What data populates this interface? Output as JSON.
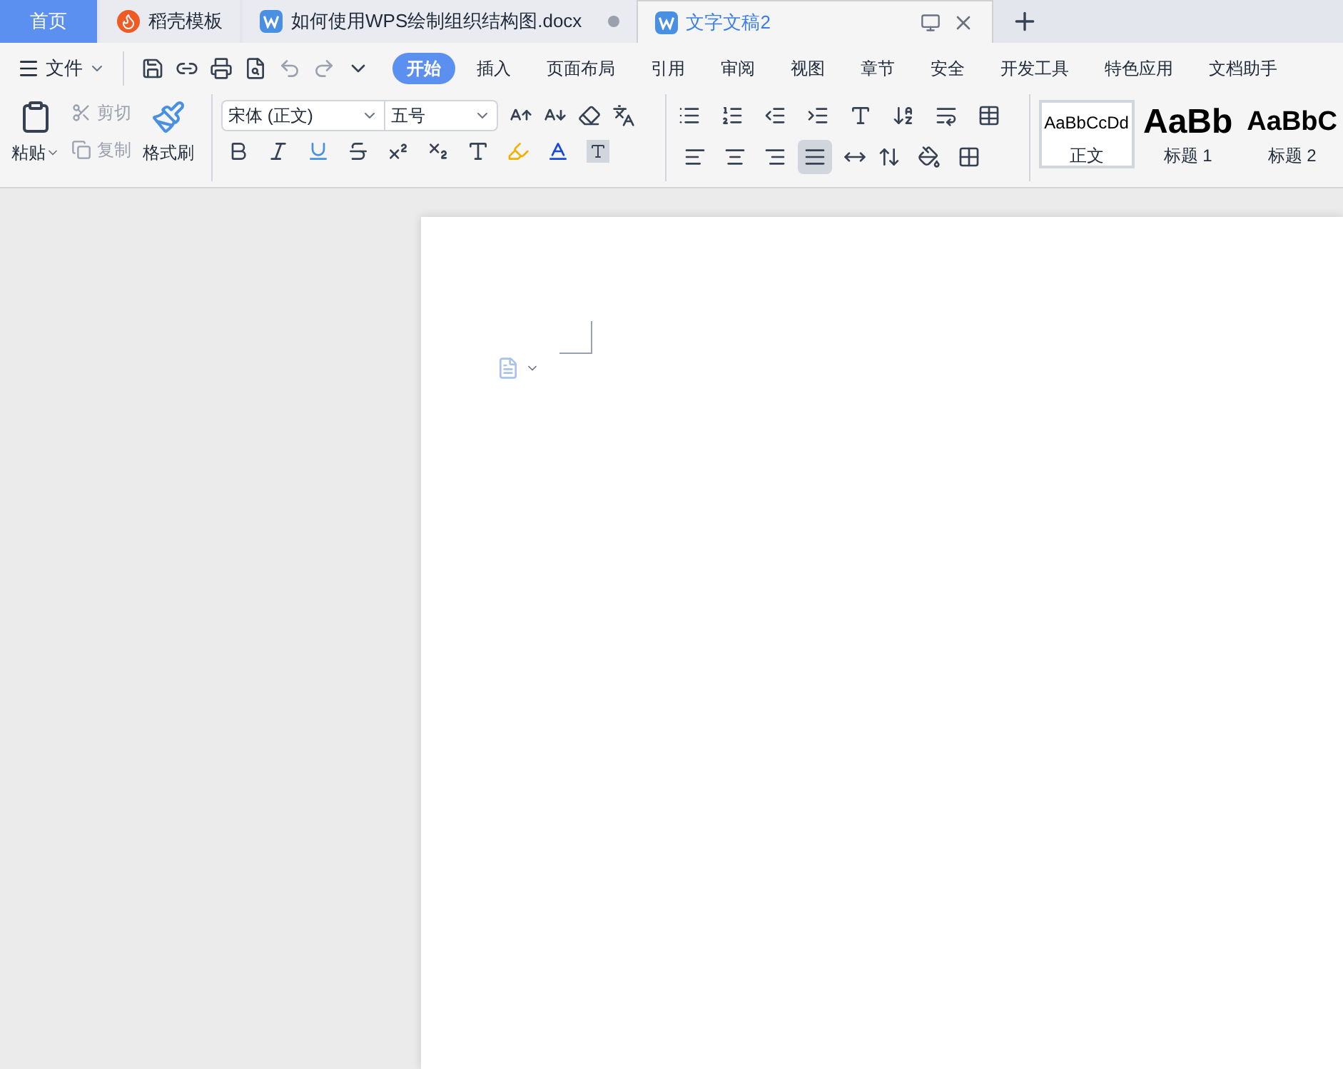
{
  "tabs": [
    {
      "label": "首页",
      "kind": "home",
      "selected": false
    },
    {
      "label": "稻壳模板",
      "kind": "app",
      "selected": false
    },
    {
      "label": "如何使用WPS绘制组织结构图.docx",
      "kind": "doc",
      "selected": false,
      "unsaved": true
    },
    {
      "label": "文字文稿2",
      "kind": "doc",
      "selected": true
    }
  ],
  "file_menu": "文件",
  "ribbon_tabs": [
    {
      "label": "开始",
      "selected": true
    },
    {
      "label": "插入",
      "selected": false
    },
    {
      "label": "页面布局",
      "selected": false
    },
    {
      "label": "引用",
      "selected": false
    },
    {
      "label": "审阅",
      "selected": false
    },
    {
      "label": "视图",
      "selected": false
    },
    {
      "label": "章节",
      "selected": false
    },
    {
      "label": "安全",
      "selected": false
    },
    {
      "label": "开发工具",
      "selected": false
    },
    {
      "label": "特色应用",
      "selected": false
    },
    {
      "label": "文档助手",
      "selected": false
    }
  ],
  "clipboard": {
    "paste": "粘贴",
    "cut": {
      "label": "剪切",
      "disabled": true
    },
    "copy": {
      "label": "复制",
      "disabled": true
    },
    "format_painter": "格式刷"
  },
  "font": {
    "name": "宋体 (正文)",
    "size": "五号"
  },
  "alignment": [
    {
      "kind": "left",
      "selected": false
    },
    {
      "kind": "center",
      "selected": false
    },
    {
      "kind": "right",
      "selected": false
    },
    {
      "kind": "justify",
      "selected": true
    },
    {
      "kind": "distribute",
      "selected": false
    }
  ],
  "styles": [
    {
      "preview": "AaBbCcDd",
      "label": "正文",
      "kind": "body",
      "selected": true
    },
    {
      "preview": "AaBb",
      "label": "标题 1",
      "kind": "h1",
      "selected": false
    },
    {
      "preview": "AaBbC",
      "label": "标题 2",
      "kind": "h2",
      "selected": false
    }
  ]
}
